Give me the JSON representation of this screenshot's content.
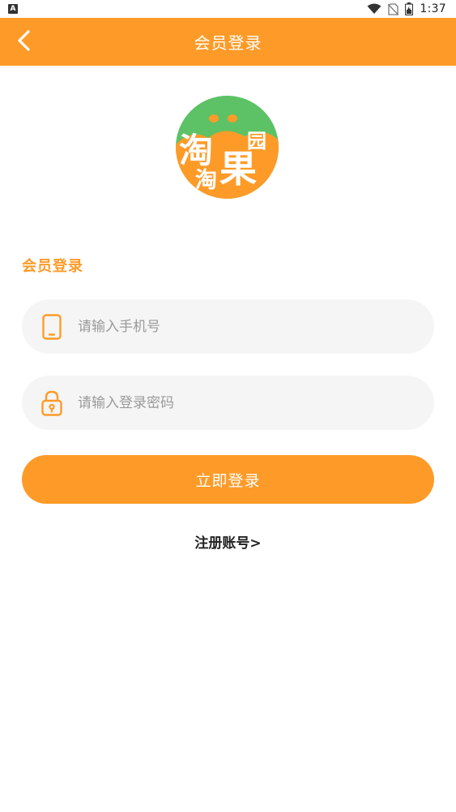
{
  "status_bar": {
    "left_badge": "A",
    "time": "1:37",
    "icons": [
      "wifi-icon",
      "no-sim-icon",
      "battery-icon"
    ]
  },
  "header": {
    "title": "会员登录",
    "back_icon": "chevron-left-icon",
    "background_color": "#FE9B28"
  },
  "logo": {
    "texts": [
      "淘",
      "淘",
      "果",
      "园"
    ],
    "background_color": "#5CC265",
    "accent_color": "#FE9B28"
  },
  "form": {
    "section_title": "会员登录",
    "phone": {
      "placeholder": "请输入手机号",
      "value": "",
      "icon": "phone-icon"
    },
    "password": {
      "placeholder": "请输入登录密码",
      "value": "",
      "icon": "lock-icon"
    },
    "submit_label": "立即登录",
    "register_link": "注册账号>"
  },
  "colors": {
    "accent": "#FE9B28",
    "input_background": "#F5F5F5",
    "placeholder": "#9A9A9A"
  }
}
